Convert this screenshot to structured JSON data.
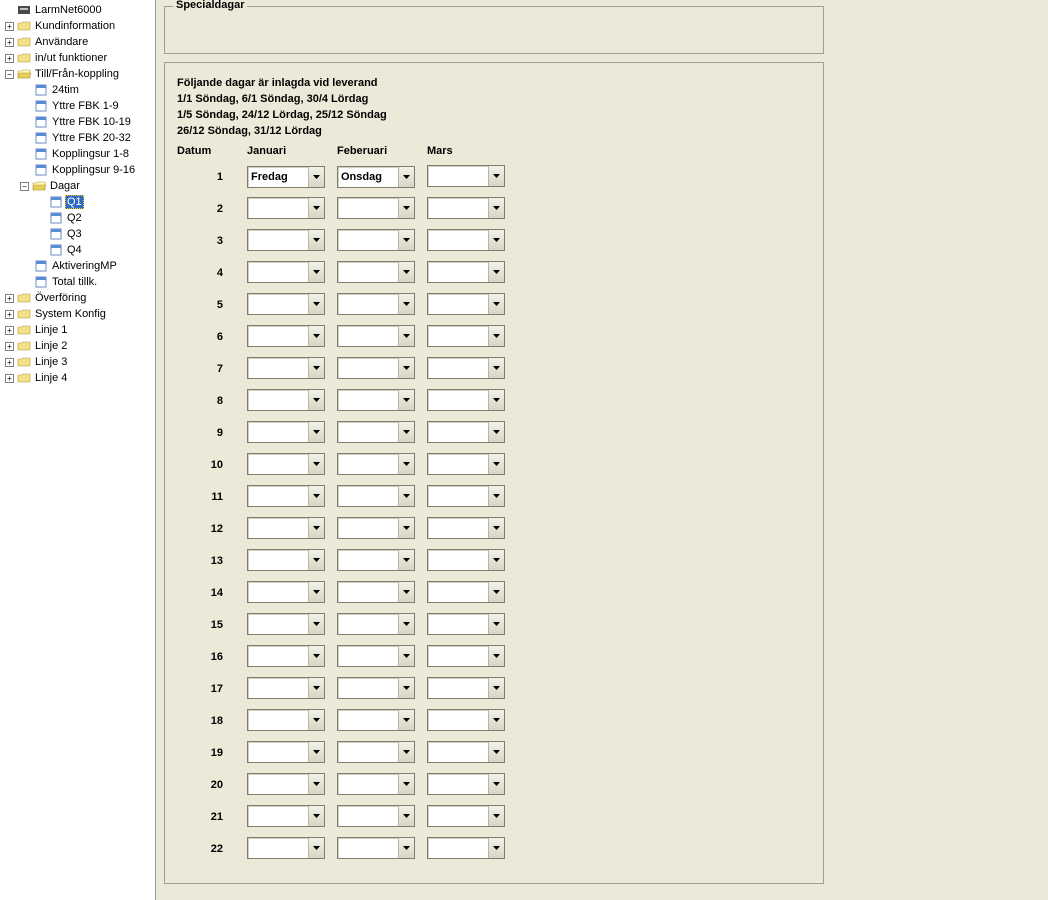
{
  "tree": {
    "root": "LarmNet6000",
    "nodes": [
      {
        "label": "Kundinformation",
        "level": 1,
        "icon": "folder-closed",
        "exp": "plus"
      },
      {
        "label": "Användare",
        "level": 1,
        "icon": "folder-closed",
        "exp": "plus"
      },
      {
        "label": "in/ut funktioner",
        "level": 1,
        "icon": "folder-closed",
        "exp": "plus"
      },
      {
        "label": "Till/Från-koppling",
        "level": 1,
        "icon": "folder-open",
        "exp": "minus"
      },
      {
        "label": "24tim",
        "level": 2,
        "icon": "doc",
        "exp": "none"
      },
      {
        "label": "Yttre FBK 1-9",
        "level": 2,
        "icon": "doc",
        "exp": "none"
      },
      {
        "label": "Yttre FBK 10-19",
        "level": 2,
        "icon": "doc",
        "exp": "none"
      },
      {
        "label": "Yttre FBK 20-32",
        "level": 2,
        "icon": "doc",
        "exp": "none"
      },
      {
        "label": "Kopplingsur 1-8",
        "level": 2,
        "icon": "doc",
        "exp": "none"
      },
      {
        "label": "Kopplingsur 9-16",
        "level": 2,
        "icon": "doc",
        "exp": "none"
      },
      {
        "label": "Dagar",
        "level": 2,
        "icon": "folder-open",
        "exp": "minus"
      },
      {
        "label": "Q1",
        "level": 3,
        "icon": "doc",
        "exp": "none",
        "selected": true
      },
      {
        "label": "Q2",
        "level": 3,
        "icon": "doc",
        "exp": "none"
      },
      {
        "label": "Q3",
        "level": 3,
        "icon": "doc",
        "exp": "none"
      },
      {
        "label": "Q4",
        "level": 3,
        "icon": "doc",
        "exp": "none"
      },
      {
        "label": "AktiveringMP",
        "level": 2,
        "icon": "doc",
        "exp": "none"
      },
      {
        "label": "Total tillk.",
        "level": 2,
        "icon": "doc",
        "exp": "none"
      },
      {
        "label": "Överföring",
        "level": 1,
        "icon": "folder-closed",
        "exp": "plus"
      },
      {
        "label": "System Konfig",
        "level": 1,
        "icon": "folder-closed",
        "exp": "plus"
      },
      {
        "label": "Linje 1",
        "level": 1,
        "icon": "folder-closed",
        "exp": "plus"
      },
      {
        "label": "Linje 2",
        "level": 1,
        "icon": "folder-closed",
        "exp": "plus"
      },
      {
        "label": "Linje 3",
        "level": 1,
        "icon": "folder-closed",
        "exp": "plus"
      },
      {
        "label": "Linje 4",
        "level": 1,
        "icon": "folder-closed",
        "exp": "plus"
      }
    ]
  },
  "panel": {
    "legend": "Specialdagar",
    "intro": [
      "Följande dagar är inlagda vid leverand",
      "1/1 Söndag, 6/1 Söndag, 30/4 Lördag",
      "1/5 Söndag, 24/12 Lördag, 25/12 Söndag",
      "26/12 Söndag, 31/12 Lördag"
    ],
    "headers": {
      "datum": "Datum",
      "months": [
        "Januari",
        "Feberuari",
        "Mars"
      ]
    },
    "rows": [
      {
        "n": "1",
        "vals": [
          "Fredag",
          "Onsdag",
          ""
        ]
      },
      {
        "n": "2",
        "vals": [
          "",
          "",
          ""
        ]
      },
      {
        "n": "3",
        "vals": [
          "",
          "",
          ""
        ]
      },
      {
        "n": "4",
        "vals": [
          "",
          "",
          ""
        ]
      },
      {
        "n": "5",
        "vals": [
          "",
          "",
          ""
        ]
      },
      {
        "n": "6",
        "vals": [
          "",
          "",
          ""
        ]
      },
      {
        "n": "7",
        "vals": [
          "",
          "",
          ""
        ]
      },
      {
        "n": "8",
        "vals": [
          "",
          "",
          ""
        ]
      },
      {
        "n": "9",
        "vals": [
          "",
          "",
          ""
        ]
      },
      {
        "n": "10",
        "vals": [
          "",
          "",
          ""
        ]
      },
      {
        "n": "11",
        "vals": [
          "",
          "",
          ""
        ]
      },
      {
        "n": "12",
        "vals": [
          "",
          "",
          ""
        ]
      },
      {
        "n": "13",
        "vals": [
          "",
          "",
          ""
        ]
      },
      {
        "n": "14",
        "vals": [
          "",
          "",
          ""
        ]
      },
      {
        "n": "15",
        "vals": [
          "",
          "",
          ""
        ]
      },
      {
        "n": "16",
        "vals": [
          "",
          "",
          ""
        ]
      },
      {
        "n": "17",
        "vals": [
          "",
          "",
          ""
        ]
      },
      {
        "n": "18",
        "vals": [
          "",
          "",
          ""
        ]
      },
      {
        "n": "19",
        "vals": [
          "",
          "",
          ""
        ]
      },
      {
        "n": "20",
        "vals": [
          "",
          "",
          ""
        ]
      },
      {
        "n": "21",
        "vals": [
          "",
          "",
          ""
        ]
      },
      {
        "n": "22",
        "vals": [
          "",
          "",
          ""
        ]
      }
    ]
  }
}
